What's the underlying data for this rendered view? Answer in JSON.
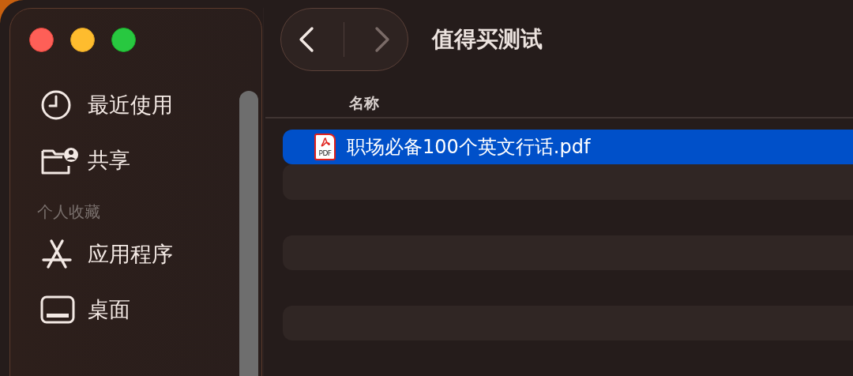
{
  "sidebar": {
    "items": [
      {
        "label": "最近使用",
        "selected": false
      },
      {
        "label": "共享",
        "selected": false
      }
    ],
    "sections": [
      {
        "title": "个人收藏",
        "items": [
          {
            "label": "应用程序",
            "selected": false
          },
          {
            "label": "桌面",
            "selected": false
          }
        ]
      }
    ]
  },
  "toolbar": {
    "back": {
      "disabled": false
    },
    "forward": {
      "disabled": true
    },
    "title": "值得买测试"
  },
  "file_list": {
    "columns": [
      "名称"
    ],
    "rows": [
      {
        "name": "职场必备100个英文行话.pdf",
        "icon_label": "PDF",
        "selected": true
      }
    ]
  }
}
